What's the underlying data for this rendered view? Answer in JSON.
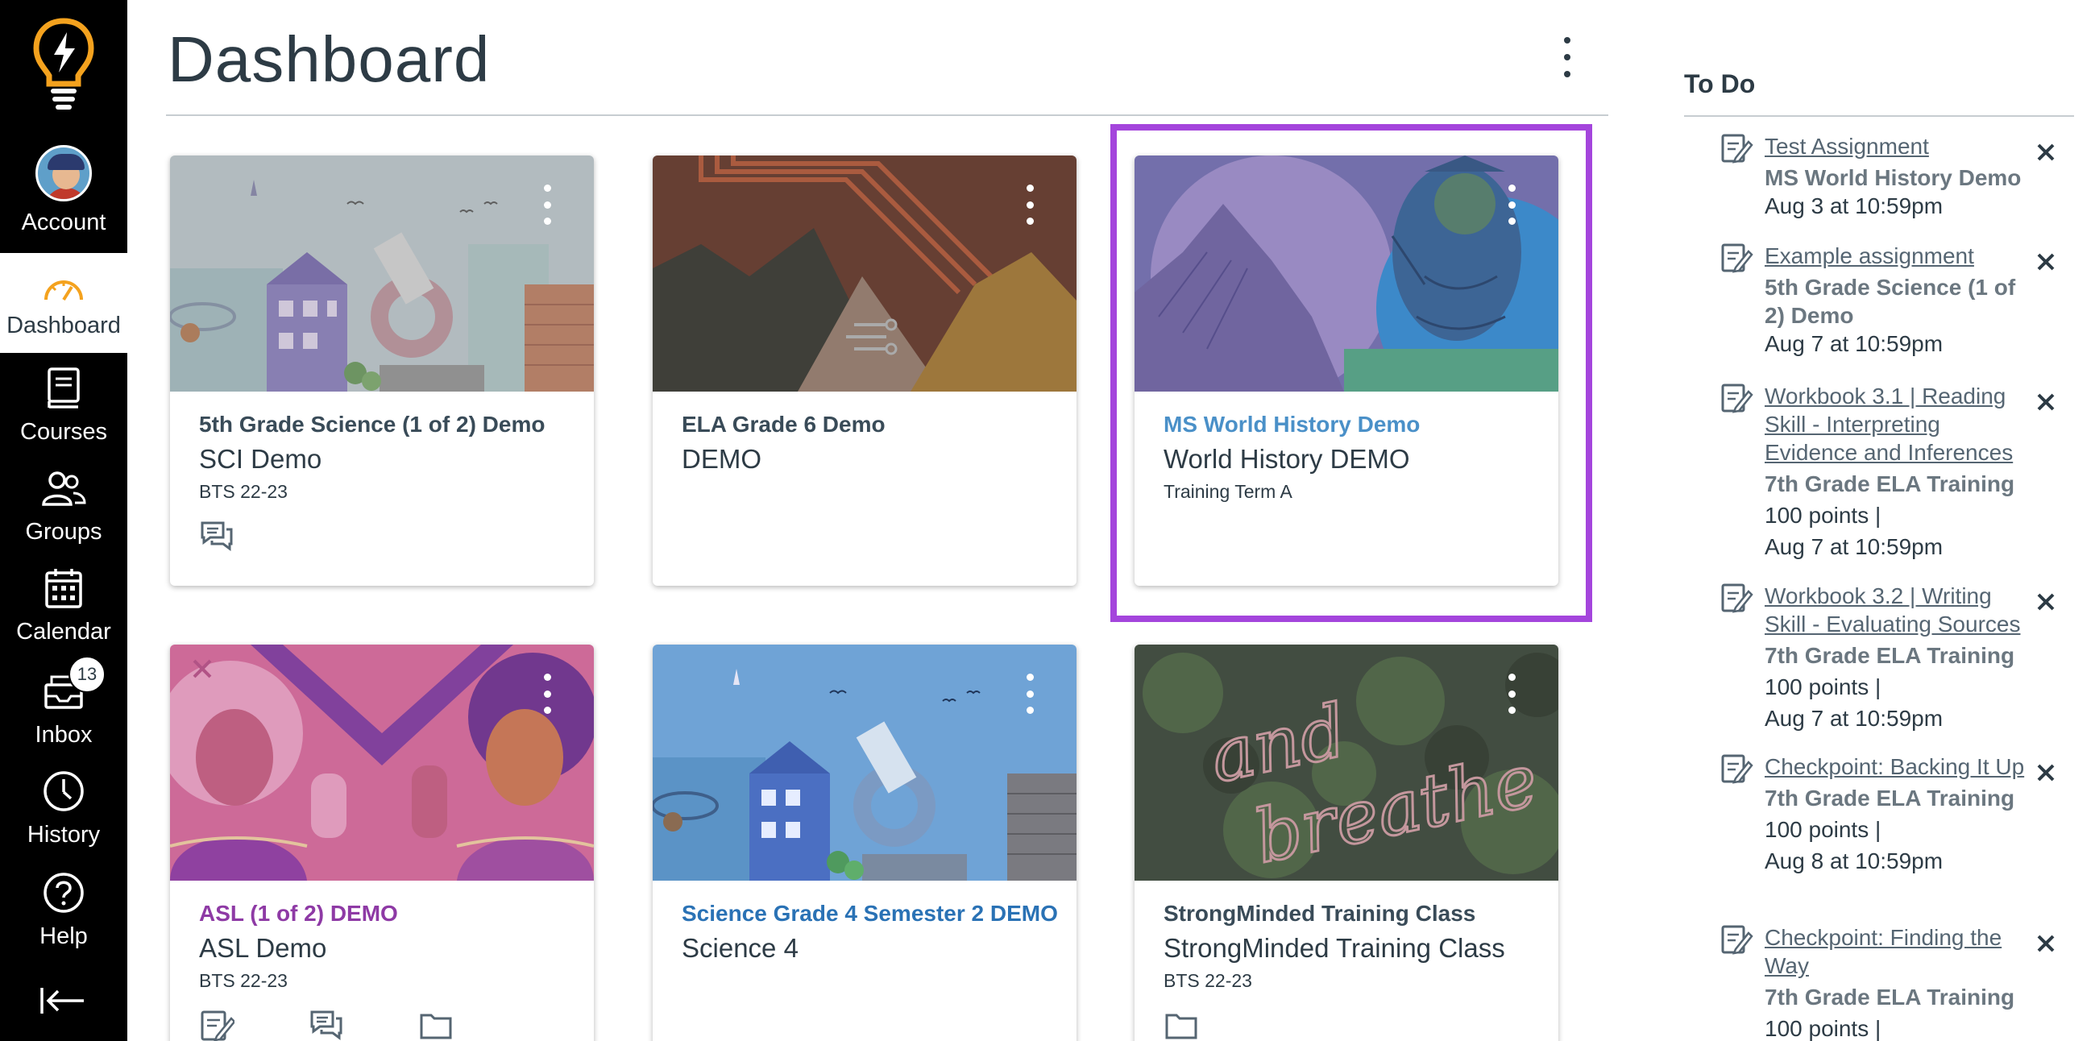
{
  "nav": {
    "account": "Account",
    "dashboard": "Dashboard",
    "courses": "Courses",
    "groups": "Groups",
    "calendar": "Calendar",
    "inbox": "Inbox",
    "inbox_badge": "13",
    "history": "History",
    "help": "Help"
  },
  "header": {
    "title": "Dashboard"
  },
  "cards": [
    {
      "course_name": "5th Grade Science (1 of 2) Demo",
      "short_name": "SCI Demo",
      "term": "BTS 22-23",
      "link_color": "#394b58"
    },
    {
      "course_name": "ELA Grade 6 Demo",
      "short_name": "DEMO",
      "term": "",
      "link_color": "#394b58"
    },
    {
      "course_name": "MS World History Demo",
      "short_name": "World History DEMO",
      "term": "Training Term A",
      "link_color": "#4a90c8"
    },
    {
      "course_name": "ASL (1 of 2) DEMO",
      "short_name": "ASL Demo",
      "term": "BTS 22-23",
      "link_color": "#8e3aa5"
    },
    {
      "course_name": "Science Grade 4 Semester 2 DEMO",
      "short_name": "Science 4",
      "term": "",
      "link_color": "#2a72b5"
    },
    {
      "course_name": "StrongMinded Training Class",
      "short_name": "StrongMinded Training Class",
      "term": "BTS 22-23",
      "link_color": "#394b58"
    }
  ],
  "hero_text": {
    "neon_line1": "and",
    "neon_line2": "breathe"
  },
  "todo": {
    "title": "To Do",
    "items": [
      {
        "link": "Test Assignment",
        "course": "MS World History Demo",
        "points": "",
        "date": "Aug 3 at 10:59pm"
      },
      {
        "link": "Example assignment",
        "course": "5th Grade Science (1 of 2) Demo",
        "points": "",
        "date": "Aug 7 at 10:59pm"
      },
      {
        "link": "Workbook 3.1 | Reading Skill - Interpreting Evidence and Inferences",
        "course": "7th Grade ELA Training",
        "points": "100 points  |",
        "date": "Aug 7 at 10:59pm"
      },
      {
        "link": "Workbook 3.2 | Writing Skill - Evaluating Sources",
        "course": "7th Grade ELA Training",
        "points": "100 points  |",
        "date": "Aug 7 at 10:59pm"
      },
      {
        "link": "Checkpoint: Backing It Up",
        "course": "7th Grade ELA Training",
        "points": "100 points  |",
        "date": "Aug 8 at 10:59pm"
      },
      {
        "link": "Checkpoint: Finding the Way",
        "course": "7th Grade ELA Training",
        "points": "100 points  |",
        "date": ""
      }
    ]
  },
  "colors": {
    "nav_bg": "#000000",
    "focus_ring": "#a445dc",
    "logo": "#f4a21e"
  }
}
